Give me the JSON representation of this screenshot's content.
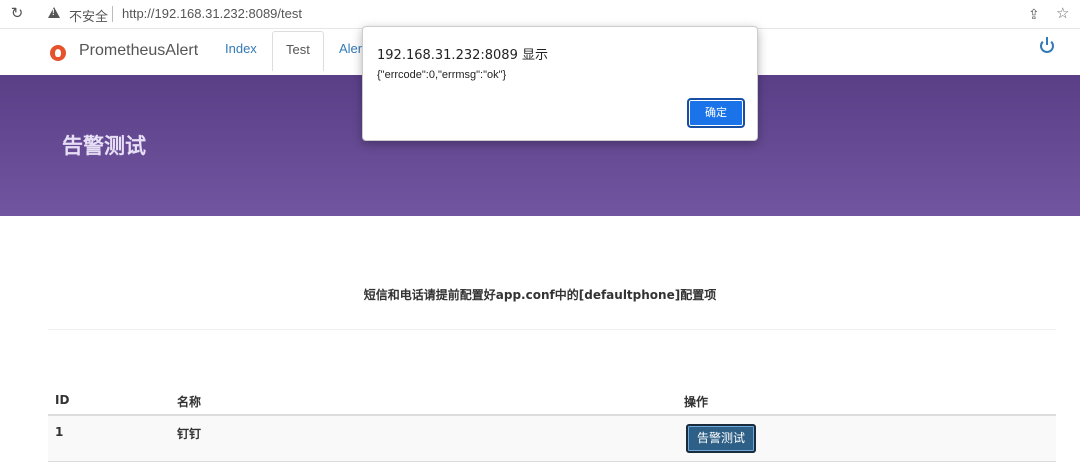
{
  "browser": {
    "reload_icon": "reload-icon",
    "security_label": "不安全",
    "url": "http://192.168.31.232:8089/test",
    "share_icon": "share-icon",
    "bookmark_icon": "star-icon"
  },
  "nav": {
    "brand": "PrometheusAlert",
    "tabs": [
      {
        "label": "Index",
        "active": false
      },
      {
        "label": "Test",
        "active": true
      },
      {
        "label": "Alert",
        "active": false
      }
    ],
    "power_icon": "power-icon"
  },
  "header": {
    "title": "告警测试",
    "gradient_colors": [
      "#5a3f87",
      "#7155a0"
    ]
  },
  "main": {
    "notice": "短信和电话请提前配置好app.conf中的[defaultphone]配置项",
    "table": {
      "headers": [
        "ID",
        "名称",
        "操作"
      ],
      "rows": [
        {
          "id": "1",
          "name": "钉钉",
          "action_label": "告警测试"
        }
      ]
    }
  },
  "dialog": {
    "title": "192.168.31.232:8089 显示",
    "message": "{\"errcode\":0,\"errmsg\":\"ok\"}",
    "ok_label": "确定"
  }
}
